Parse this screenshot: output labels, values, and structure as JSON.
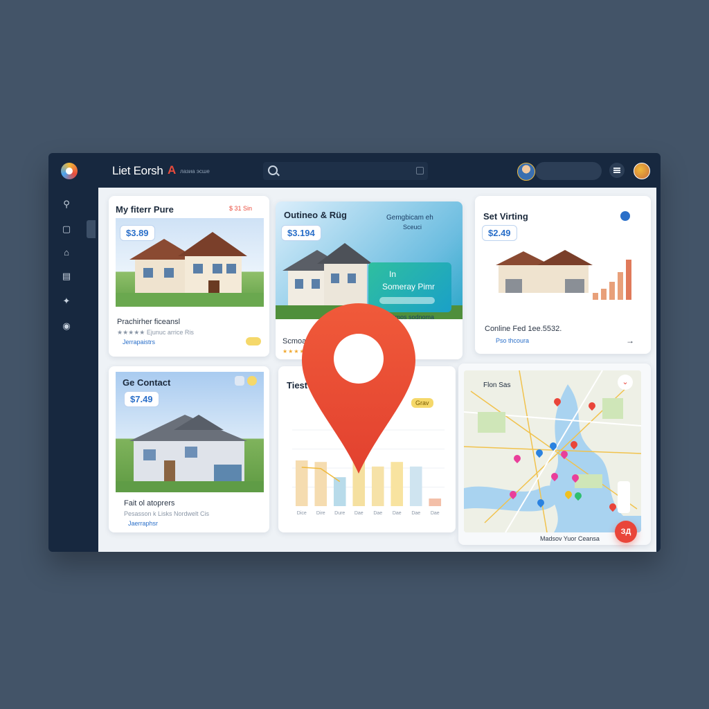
{
  "app": {
    "title": "Liet Eorsh",
    "title_accent": "A",
    "subtitle": "лазиа эсше"
  },
  "search": {
    "placeholder": ""
  },
  "sidebar": {
    "items": [
      {
        "icon": "search-icon"
      },
      {
        "icon": "book-icon"
      },
      {
        "icon": "home-icon"
      },
      {
        "icon": "inbox-icon"
      },
      {
        "icon": "puzzle-icon"
      },
      {
        "icon": "settings-icon"
      }
    ]
  },
  "cards": {
    "c1": {
      "title": "My fiterr Pure",
      "tag": "$ 31 Sin",
      "price": "$3.89",
      "subtitle": "Prachirher ficeansl",
      "meta": "★★★★★ Ejunuc arrice Ris",
      "note": "Jerrapaistrs"
    },
    "c2": {
      "title": "Outineo & Rüg",
      "price": "$3.194",
      "overlay_title": "Gemgbicam eh",
      "overlay_sub": "Sceuci",
      "popup_line1": "In",
      "popup_line2": "Someray Pimr",
      "popup_foot": "Dmos sodnoma",
      "subtitle": "Scmoals",
      "meta": "★★★★"
    },
    "c3": {
      "title": "Set Virting",
      "price": "$2.49",
      "subtitle": "Conline Fed 1ee.5532.",
      "note": "Pso thcoura"
    },
    "c4": {
      "title": "Ge Contact",
      "price": "$7.49",
      "subtitle": "Fait ol atoprers",
      "meta": "Pesasson k Lisks Nordwelt Cis",
      "note": "Jaerraphsr"
    },
    "c5": {
      "title": "Tiest",
      "badge": "Grav",
      "axis_labels": [
        "Dice",
        "Dire",
        "Dure",
        "Dae",
        "Dae",
        "Dae",
        "Dae"
      ]
    },
    "c6": {
      "title": "Flon Sas",
      "footer": "Madsov Yuor Ceansa"
    }
  },
  "chart_data": {
    "type": "bar",
    "title": "Tiest",
    "categories": [
      "Dice",
      "Dire",
      "Dure",
      "Dae",
      "Dae",
      "Dae",
      "Dae",
      "Dae"
    ],
    "values": [
      60,
      58,
      38,
      72,
      52,
      58,
      52,
      10
    ],
    "ylim": [
      0,
      100
    ]
  },
  "fab": {
    "label": "ЗД"
  }
}
